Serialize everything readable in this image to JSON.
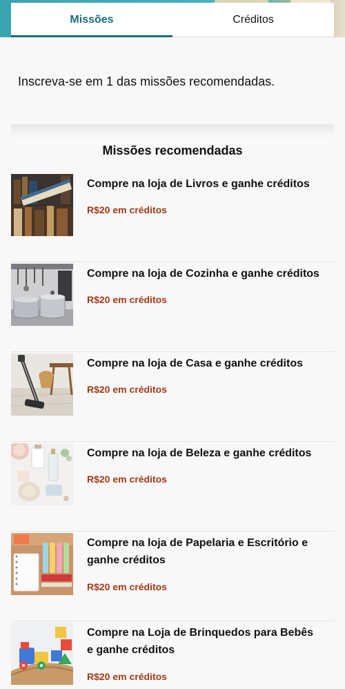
{
  "tabs": [
    {
      "label": "Missões",
      "active": true
    },
    {
      "label": "Créditos",
      "active": false
    }
  ],
  "instruction": "Inscreva-se em 1 das missões recomendadas.",
  "section_title": "Missões recomendadas",
  "missions": [
    {
      "title": "Compre na loja de Livros e ganhe créditos",
      "reward": "R$20 em créditos",
      "image": "books-image"
    },
    {
      "title": "Compre na loja de Cozinha e ganhe créditos",
      "reward": "R$20 em créditos",
      "image": "kitchen-image"
    },
    {
      "title": "Compre na loja de Casa e ganhe créditos",
      "reward": "R$20 em créditos",
      "image": "home-image"
    },
    {
      "title": "Compre na loja de Beleza e ganhe créditos",
      "reward": "R$20 em créditos",
      "image": "beauty-image"
    },
    {
      "title": "Compre na loja de Papelaria e Escritório e ganhe créditos",
      "reward": "R$20 em créditos",
      "image": "stationery-image"
    },
    {
      "title": "Compre na Loja de Brinquedos para Bebês e ganhe créditos",
      "reward": "R$20 em créditos",
      "image": "baby-toys-image"
    }
  ],
  "colors": {
    "active_tab": "#1a6a80",
    "reward": "#a13a16",
    "banner": "#43b0bd"
  }
}
